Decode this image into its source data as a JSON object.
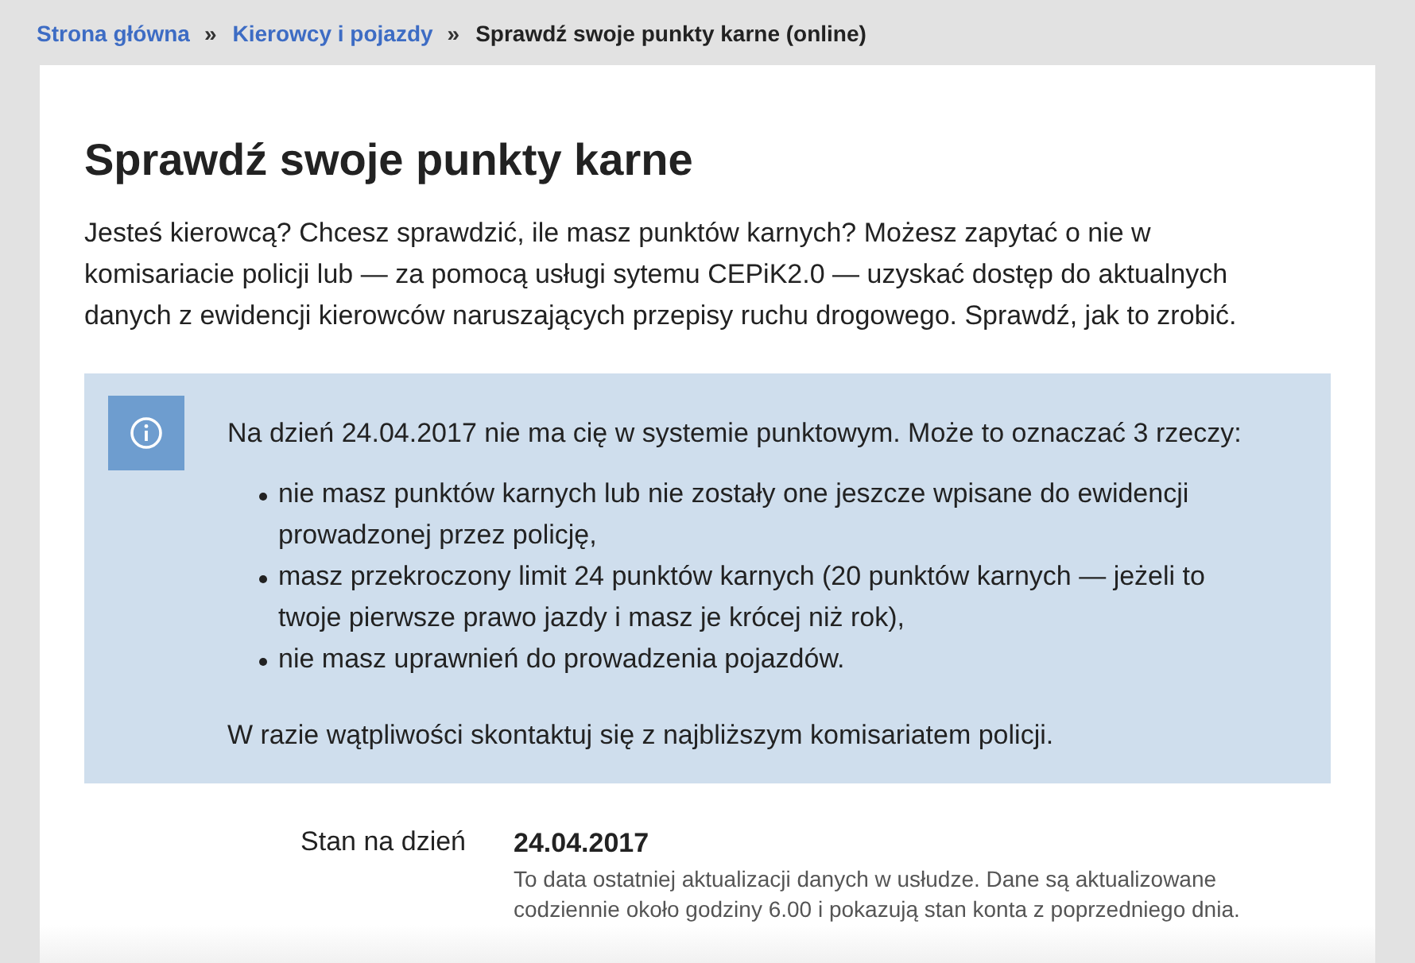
{
  "breadcrumb": [
    {
      "label": "Strona główna",
      "kind": "link",
      "separator": "»"
    },
    {
      "label": "Kierowcy i pojazdy",
      "kind": "link",
      "separator": "»"
    },
    {
      "label": "Sprawdź swoje punkty karne (online)",
      "kind": "current"
    }
  ],
  "title": "Sprawdź swoje punkty karne",
  "intro": "Jesteś kierowcą? Chcesz sprawdzić, ile masz punktów karnych? Możesz zapytać o nie w komisariacie policji lub — za pomocą usługi sytemu CEPiK2.0 — uzyskać dostęp do aktualnych danych z ewidencji kierowców naruszających przepisy ruchu drogowego. Sprawdź, jak to zrobić.",
  "notice": {
    "lead": "Na dzień 24.04.2017 nie ma cię w systemie punktowym. Może to oznaczać 3 rzeczy:",
    "items": [
      "nie masz punktów karnych lub nie zostały one jeszcze wpisane do ewidencji prowadzonej przez policję,",
      "masz przekroczony limit 24 punktów karnych (20 punktów karnych — jeżeli to twoje pierwsze prawo jazdy i masz je krócej niż rok),",
      "nie masz uprawnień do prowadzenia pojazdów."
    ],
    "footer": "W razie wątpliwości skontaktuj się z najbliższym komisariatem policji."
  },
  "status": {
    "label": "Stan na dzień",
    "value": "24.04.2017",
    "note": "To data ostatniej aktualizacji danych w usłudze. Dane są aktualizowane codziennie około godziny 6.00 i pokazują stan konta z poprzedniego dnia."
  }
}
